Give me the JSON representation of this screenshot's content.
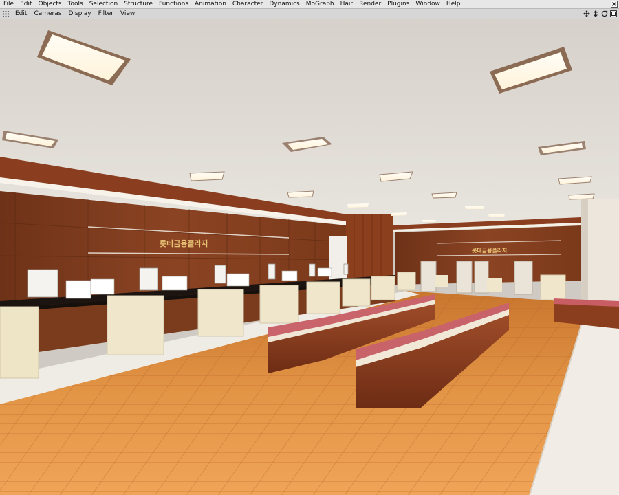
{
  "menubar": {
    "items": [
      "File",
      "Edit",
      "Objects",
      "Tools",
      "Selection",
      "Structure",
      "Functions",
      "Animation",
      "Character",
      "Dynamics",
      "MoGraph",
      "Hair",
      "Render",
      "Plugins",
      "Window",
      "Help"
    ]
  },
  "viewport_menu": {
    "items": [
      "Edit",
      "Cameras",
      "Display",
      "Filter",
      "View"
    ],
    "nav_icons": [
      "move-icon",
      "zoom-icon",
      "rotate-icon",
      "maximize-icon"
    ]
  },
  "scene": {
    "sign_left": "롯데금융플라자",
    "sign_right": "롯데금융플라자",
    "colors": {
      "ceiling": "#dcd7d0",
      "wood_wall": "#7a3b1c",
      "floor": "#d98a3e",
      "seat_cushion": "#c9636a",
      "chair": "#efe6cc"
    }
  }
}
